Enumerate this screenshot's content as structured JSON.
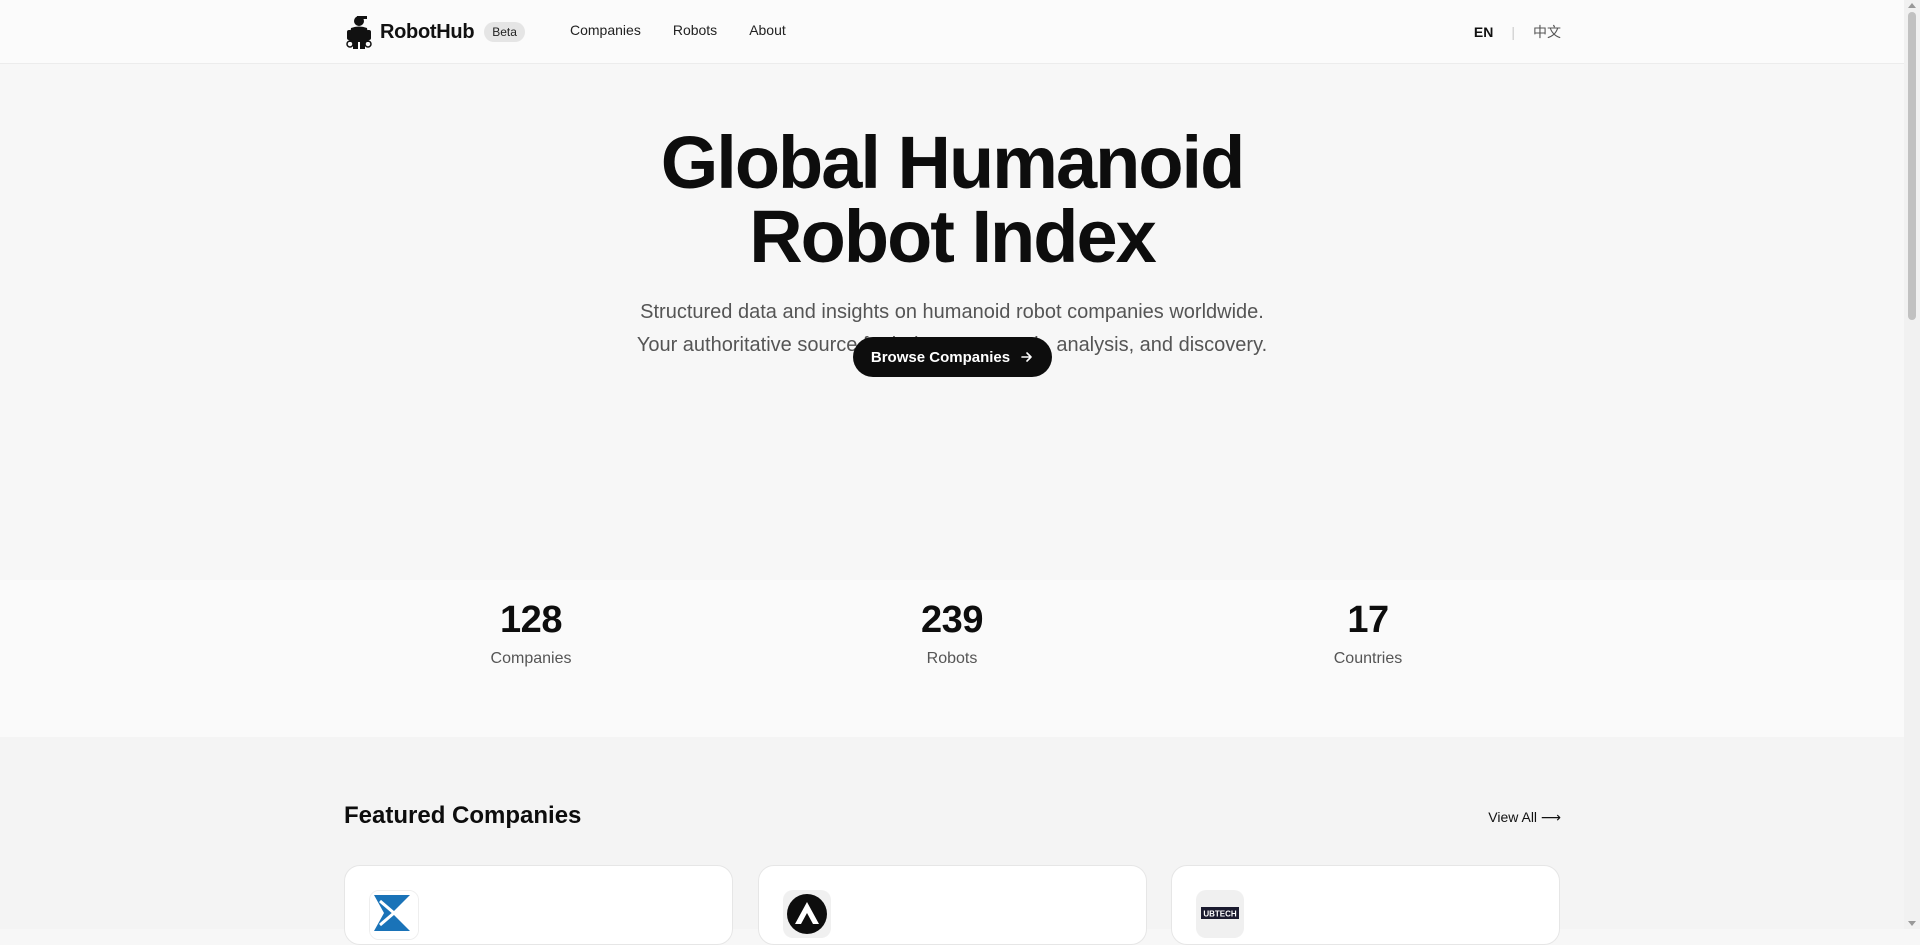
{
  "nav": {
    "brand": "RobotHub",
    "badge": "Beta",
    "links": [
      "Companies",
      "Robots",
      "About"
    ],
    "lang_en": "EN",
    "lang_separator": "|",
    "lang_zh": "中文"
  },
  "hero": {
    "title_line1": "Global Humanoid",
    "title_line2": "Robot Index",
    "subtitle_line1": "Structured data and insights on humanoid robot companies worldwide.",
    "subtitle_line2": "Your authoritative source for industry research, analysis, and discovery.",
    "cta_label": "Browse Companies",
    "cta_icon": "arrow-right-icon"
  },
  "stats": [
    {
      "value": "128",
      "label": "Companies"
    },
    {
      "value": "239",
      "label": "Robots"
    },
    {
      "value": "17",
      "label": "Countries"
    }
  ],
  "featured": {
    "title": "Featured Companies",
    "view_all": "View All ⟶",
    "cards": [
      {
        "logo": "blue-chevron-logo"
      },
      {
        "logo": "black-triangle-logo"
      },
      {
        "logo_text": "UBTECH"
      }
    ]
  },
  "colors": {
    "accent": "#0d0d0d",
    "background": "#f7f7f7",
    "muted_text": "#555555"
  }
}
